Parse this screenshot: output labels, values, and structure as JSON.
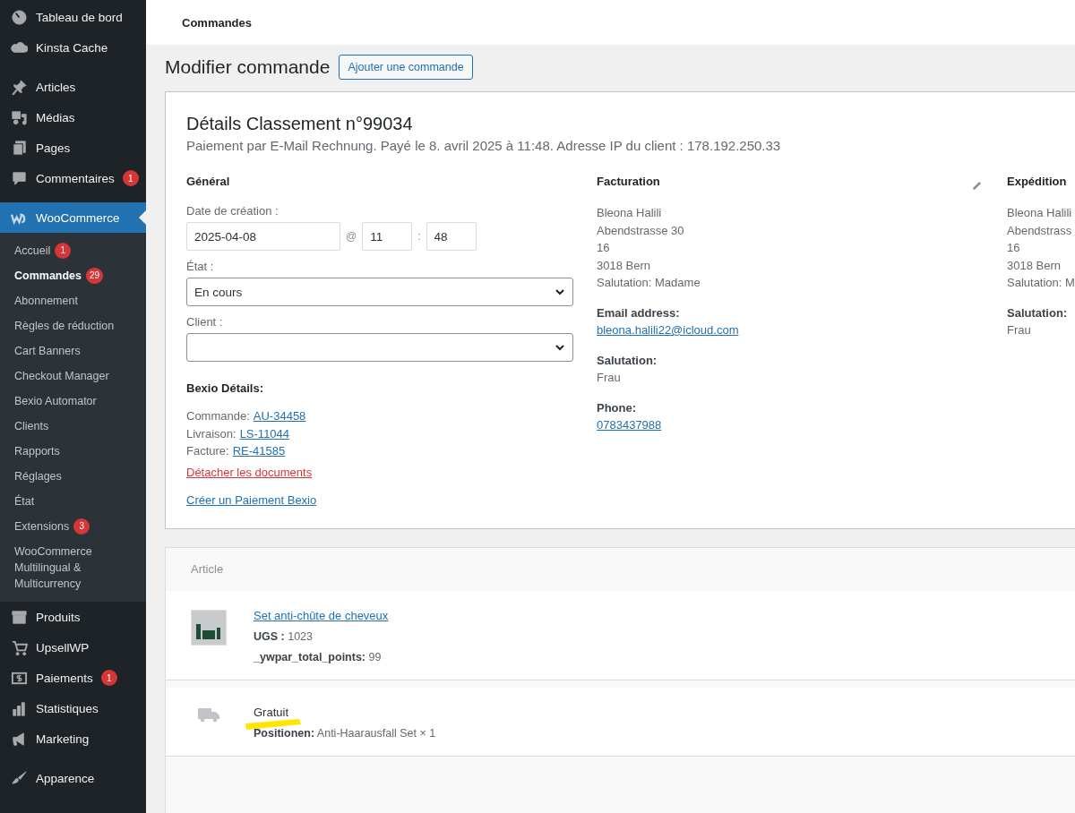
{
  "sidebar": {
    "groups": [
      {
        "items": [
          {
            "label": "Tableau de bord",
            "kind": "gauge",
            "selected": false
          },
          {
            "label": "Kinsta Cache",
            "kind": "cloud",
            "selected": false
          }
        ]
      },
      {
        "items": [
          {
            "label": "Articles",
            "kind": "pin",
            "selected": false
          },
          {
            "label": "Médias",
            "kind": "media",
            "selected": false
          },
          {
            "label": "Pages",
            "kind": "pages",
            "selected": false
          },
          {
            "label": "Commentaires",
            "kind": "bubble",
            "badge": "1",
            "selected": false
          }
        ]
      },
      {
        "items": [
          {
            "label": "WooCommerce",
            "kind": "woo",
            "selected": true,
            "children": [
              {
                "label": "Accueil",
                "badge": "1",
                "selected": false
              },
              {
                "label": "Commandes",
                "badge": "29",
                "selected": true
              },
              {
                "label": "Abonnement",
                "selected": false
              },
              {
                "label": "Règles de réduction",
                "selected": false
              },
              {
                "label": "Cart Banners",
                "selected": false
              },
              {
                "label": "Checkout Manager",
                "selected": false
              },
              {
                "label": "Bexio Automator",
                "selected": false
              },
              {
                "label": "Clients",
                "selected": false
              },
              {
                "label": "Rapports",
                "selected": false
              },
              {
                "label": "Réglages",
                "selected": false
              },
              {
                "label": "État",
                "selected": false
              },
              {
                "label": "Extensions",
                "badge": "3",
                "selected": false
              },
              {
                "label": "WooCommerce Multilingual & Multicurrency",
                "selected": false
              }
            ]
          },
          {
            "label": "Produits",
            "kind": "box",
            "selected": false
          },
          {
            "label": "UpsellWP",
            "kind": "cart",
            "selected": false
          },
          {
            "label": "Paiements",
            "kind": "dollar",
            "badge": "1",
            "selected": false
          },
          {
            "label": "Statistiques",
            "kind": "bars",
            "selected": false
          },
          {
            "label": "Marketing",
            "kind": "megaphone",
            "selected": false
          }
        ]
      },
      {
        "items": [
          {
            "label": "Apparence",
            "kind": "brush",
            "selected": false
          }
        ]
      }
    ]
  },
  "header": {
    "title": "Commandes"
  },
  "page": {
    "title": "Modifier commande",
    "add_button": "Ajouter une commande"
  },
  "order": {
    "title": "Détails Classement n°99034",
    "subtitle": "Paiement par E-Mail Rechnung. Payé le 8. avril 2025 à 11:48. Adresse IP du client : 178.192.250.33",
    "general": {
      "heading": "Général",
      "date_label": "Date de création :",
      "date": "2025-04-08",
      "at": "@",
      "hour": "11",
      "colon": ":",
      "minute": "48",
      "status_label": "État :",
      "status": "En cours",
      "client_label": "Client :",
      "bexio_heading": "Bexio Détails:",
      "bexio_docs": [
        {
          "label": "Commande:",
          "link": "AU-34458"
        },
        {
          "label": "Livraison:",
          "link": "LS-11044"
        },
        {
          "label": "Facture:",
          "link": "RE-41585"
        }
      ],
      "detach_link": "Détacher les documents",
      "payment_link": "Créer un Paiement Bexio"
    },
    "billing": {
      "heading": "Facturation",
      "address": [
        "Bleona Halili",
        "Abendstrasse 30",
        "16",
        "3018 Bern",
        "Salutation: Madame"
      ],
      "fields": [
        {
          "label": "Email address:",
          "value": "bleona.halili22@icloud.com",
          "kind": "link"
        },
        {
          "label": "Salutation:",
          "value": "Frau",
          "kind": "text"
        },
        {
          "label": "Phone:",
          "value": "0783437988",
          "kind": "link"
        }
      ]
    },
    "shipping": {
      "heading": "Expédition",
      "address": [
        "Bleona Halili",
        "Abendstrass",
        "16",
        "3018 Bern",
        "Salutation: M"
      ],
      "fields": [
        {
          "label": "Salutation:",
          "value": "Frau",
          "kind": "text"
        }
      ]
    }
  },
  "items": {
    "column": "Article",
    "products": [
      {
        "name": "Set anti-chûte de cheveux",
        "meta": [
          {
            "label": "UGS :",
            "value": "1023"
          },
          {
            "label": "_ywpar_total_points:",
            "value": "99"
          }
        ]
      }
    ],
    "shipping_lines": [
      {
        "name": "Gratuit",
        "meta": [
          {
            "label": "Positionen:",
            "value": "Anti-Haarausfall Set × 1"
          }
        ]
      }
    ]
  }
}
